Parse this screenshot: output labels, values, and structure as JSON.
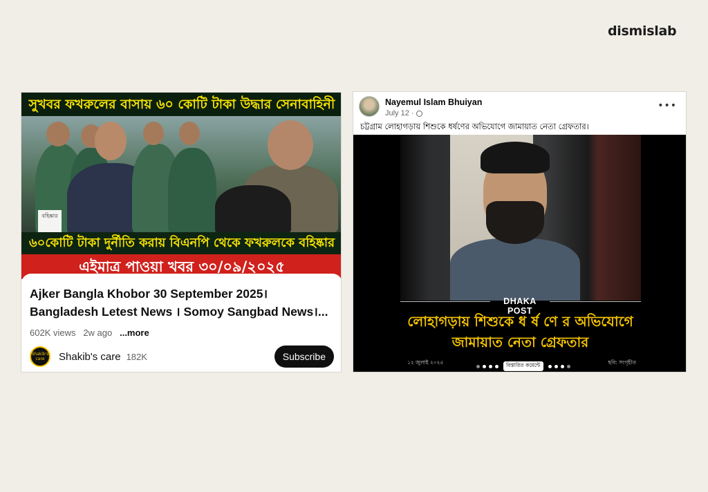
{
  "brand": {
    "logo_text": "dismislab"
  },
  "youtube": {
    "thumbnail": {
      "top_banner": "সুখবর ফখরুলের বাসায় ৬০ কোটি টাকা উদ্ধার সেনাবাহিনী",
      "mid_banner": "৬০কোটি টাকা দুর্নীতি করায় বিএনপি থেকে ফখরুলকে বহিষ্কার",
      "red_banner": "এইমাত্র পাওয়া খবর ৩০/০৯/২০২৫",
      "paper_text": "বহিষ্কার"
    },
    "title_line1": "Ajker Bangla Khobor 30 September 2025।",
    "title_line2": "Bangladesh Letest News । Somoy Sangbad News।...",
    "views": "602K views",
    "age": "2w ago",
    "more_label": "...more",
    "channel_avatar_text": "Shakib's care",
    "channel_name": "Shakib's care",
    "subscribers": "182K",
    "subscribe_label": "Subscribe"
  },
  "facebook": {
    "author": "Nayemul Islam Bhuiyan",
    "date": "July 12 ·",
    "menu_icon": "•••",
    "caption": "চট্টগ্রাম লোহাগড়ায় শিশুকে ধর্ষণের অভিযোগে জামায়াত নেতা গ্রেফতার।",
    "card": {
      "source_logo": "DHAKA POST",
      "headline_line1": "লোহাগড়ায় শিশুকে ধ র্ষ ণে র অভিযোগে",
      "headline_line2": "জামায়াত নেতা গ্রেফতার",
      "date_text": "১২ জুলাই ২০২৫",
      "details_button": "বিস্তারিত কমেন্টে",
      "credit": "ছবি: সংগৃহীত"
    }
  },
  "colors": {
    "background": "#f1eee7",
    "banner_yellow": "#f7e300",
    "banner_red": "#d0211c",
    "dhakapost_yellow": "#f5c400"
  }
}
